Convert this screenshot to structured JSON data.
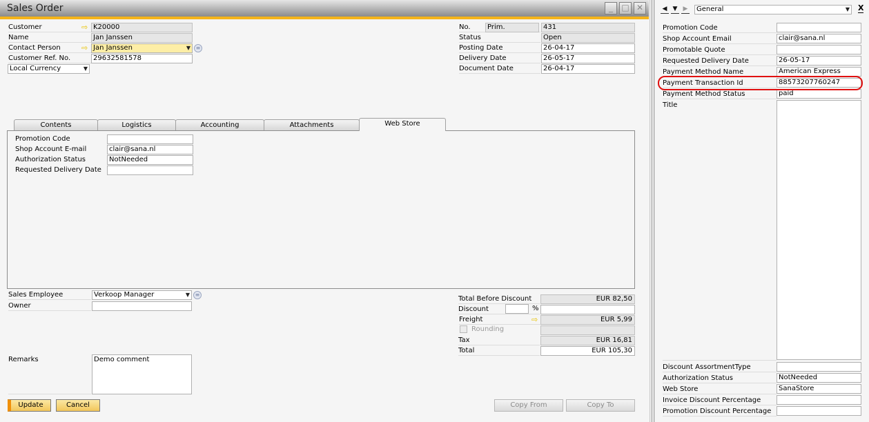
{
  "window": {
    "title": "Sales Order",
    "controls": [
      "minimize-icon",
      "maximize-icon",
      "close-icon"
    ]
  },
  "header_left": {
    "customer": {
      "label": "Customer",
      "value": "K20000"
    },
    "name": {
      "label": "Name",
      "value": "Jan Janssen"
    },
    "contact_person": {
      "label": "Contact Person",
      "value": "Jan Janssen"
    },
    "customer_ref": {
      "label": "Customer Ref. No.",
      "value": "29632581578"
    },
    "currency": {
      "value": "Local Currency"
    }
  },
  "header_right": {
    "no": {
      "label": "No.",
      "series": "Prim.",
      "value": "431"
    },
    "status": {
      "label": "Status",
      "value": "Open"
    },
    "posting_date": {
      "label": "Posting Date",
      "value": "26-04-17"
    },
    "delivery_date": {
      "label": "Delivery Date",
      "value": "26-05-17"
    },
    "document_date": {
      "label": "Document Date",
      "value": "26-04-17"
    }
  },
  "tabs": [
    {
      "label": "Contents"
    },
    {
      "label": "Logistics"
    },
    {
      "label": "Accounting"
    },
    {
      "label": "Attachments"
    },
    {
      "label": "Web Store",
      "active": true
    }
  ],
  "webstore": {
    "promotion_code": {
      "label": "Promotion Code",
      "value": ""
    },
    "shop_email": {
      "label": "Shop Account E-mail",
      "value": "clair@sana.nl"
    },
    "auth_status": {
      "label": "Authorization Status",
      "value": "NotNeeded"
    },
    "req_delivery": {
      "label": "Requested Delivery Date",
      "value": ""
    }
  },
  "footer_left": {
    "sales_employee": {
      "label": "Sales Employee",
      "value": "Verkoop Manager"
    },
    "owner": {
      "label": "Owner",
      "value": ""
    },
    "remarks": {
      "label": "Remarks",
      "value": "Demo comment"
    }
  },
  "totals": {
    "before_discount": {
      "label": "Total Before Discount",
      "value": "EUR 82,50"
    },
    "discount": {
      "label": "Discount",
      "percent": "",
      "percent_sign": "%",
      "value": ""
    },
    "freight": {
      "label": "Freight",
      "value": "EUR 5,99"
    },
    "rounding": {
      "label": "Rounding",
      "checked": false,
      "value": ""
    },
    "tax": {
      "label": "Tax",
      "value": "EUR 16,81"
    },
    "total": {
      "label": "Total",
      "value": "EUR 105,30"
    }
  },
  "buttons": {
    "update": "Update",
    "cancel": "Cancel",
    "copy_from": "Copy From",
    "copy_to": "Copy To"
  },
  "udf_panel": {
    "category": "General",
    "close": "X",
    "fields": [
      {
        "label": "Promotion Code",
        "value": ""
      },
      {
        "label": "Shop Account Email",
        "value": "clair@sana.nl"
      },
      {
        "label": "Promotable Quote",
        "value": ""
      },
      {
        "label": "Requested Delivery Date",
        "value": "26-05-17"
      },
      {
        "label": "Payment Method Name",
        "value": "American Express"
      },
      {
        "label": "Payment Transaction Id",
        "value": "88573207760247",
        "highlighted": true
      },
      {
        "label": "Payment Method Status",
        "value": "paid"
      },
      {
        "label": "Title",
        "value": ""
      },
      {
        "label": "Discount AssortmentType",
        "value": ""
      },
      {
        "label": "Authorization Status",
        "value": "NotNeeded"
      },
      {
        "label": "Web Store",
        "value": "SanaStore"
      },
      {
        "label": "Invoice Discount Percentage",
        "value": ""
      },
      {
        "label": "Promotion Discount Percentage",
        "value": ""
      }
    ],
    "highlight_color": "#e01010"
  }
}
